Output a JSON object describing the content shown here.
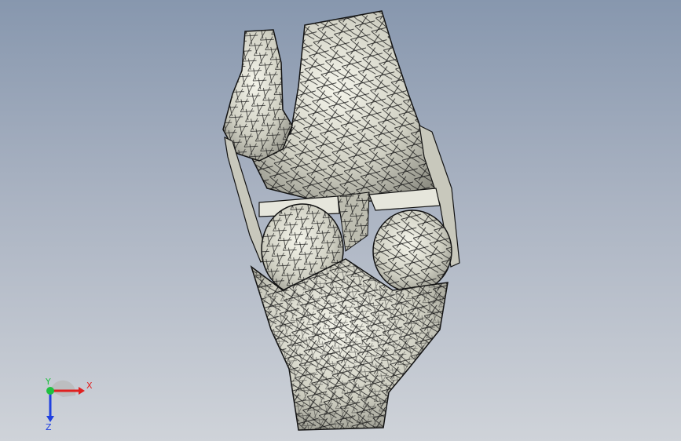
{
  "viewport": {
    "background_top": "#8797ae",
    "background_bottom": "#cfd3d9",
    "model_fill": "#d8d8cc",
    "mesh_color": "#1a1a1a"
  },
  "triad": {
    "x_label": "X",
    "y_label": "Y",
    "z_label": "Z",
    "x_color": "#e02020",
    "y_color": "#20c040",
    "z_color": "#2040e0"
  }
}
